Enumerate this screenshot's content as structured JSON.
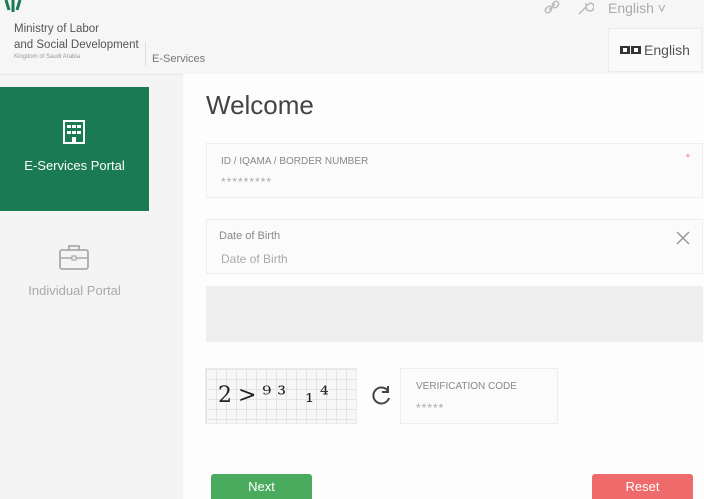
{
  "header": {
    "brand_line1": "Ministry of Labor",
    "brand_line2": "and Social Development",
    "brand_line3": "Kingdom of Saudi Arabia",
    "section": "E-Services",
    "language_select": "English ˅",
    "language_button": "English"
  },
  "sidebar": {
    "items": [
      {
        "label": "E-Services Portal",
        "active": true,
        "icon": "building-icon"
      },
      {
        "label": "Individual Portal",
        "active": false,
        "icon": "briefcase-icon"
      }
    ]
  },
  "form": {
    "title": "Welcome",
    "id_field": {
      "label": "ID / IQAMA / BORDER NUMBER",
      "value": "*********",
      "required_mark": "*"
    },
    "dob_field": {
      "label": "Date of Birth",
      "placeholder": "Date of Birth"
    },
    "captcha": {
      "text": "2>⁹³ ₁⁴",
      "icon": "refresh-icon"
    },
    "verification_field": {
      "label": "VERIFICATION CODE",
      "value": "*****"
    },
    "next_label": "Next",
    "reset_label": "Reset"
  },
  "colors": {
    "primary": "#1a7a52",
    "next": "#4aab5e",
    "reset": "#ef6a6a"
  }
}
